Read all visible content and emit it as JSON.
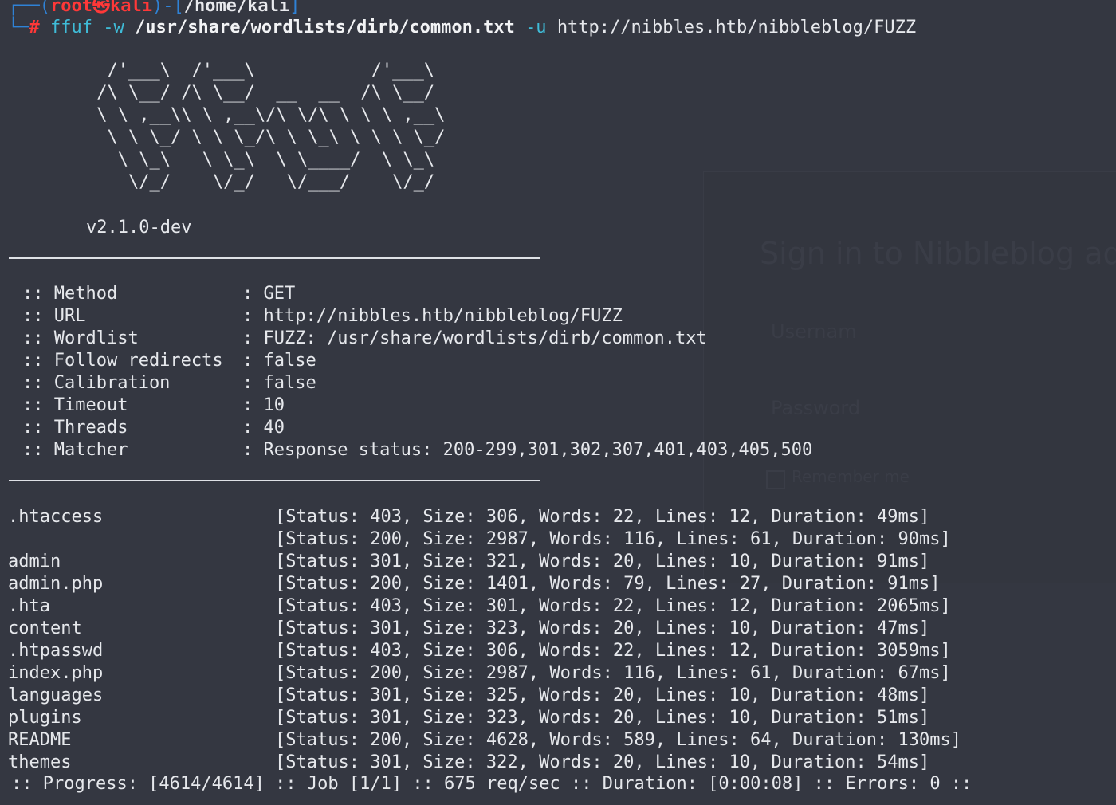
{
  "prompt": {
    "user": "root㉿kali",
    "path": "/home/kali",
    "hash": "#",
    "command": "ffuf",
    "wordlist_flag": "-w",
    "wordlist_path": "/usr/share/wordlists/dirb/common.txt",
    "url_flag": "-u",
    "url": "http://nibbles.htb/nibbleblog/FUZZ"
  },
  "banner": {
    "ascii": "  /'___\\  /'___\\           /'___\\\n /\\ \\__/ /\\ \\__/  __  __  /\\ \\__/\n \\ \\ ,__\\\\ \\ ,__\\/\\ \\/\\ \\ \\ \\ ,__\\\n  \\ \\ \\_/ \\ \\ \\_/\\ \\ \\_\\ \\ \\ \\ \\_/\n   \\ \\_\\   \\ \\_\\  \\ \\____/  \\ \\_\\\n    \\/_/    \\/_/   \\/___/    \\/_/",
    "version": "v2.1.0-dev"
  },
  "config": [
    {
      "key": ":: Method",
      "value": ": GET"
    },
    {
      "key": ":: URL",
      "value": ": http://nibbles.htb/nibbleblog/FUZZ"
    },
    {
      "key": ":: Wordlist",
      "value": ": FUZZ: /usr/share/wordlists/dirb/common.txt"
    },
    {
      "key": ":: Follow redirects",
      "value": ": false"
    },
    {
      "key": ":: Calibration",
      "value": ": false"
    },
    {
      "key": ":: Timeout",
      "value": ": 10"
    },
    {
      "key": ":: Threads",
      "value": ": 40"
    },
    {
      "key": ":: Matcher",
      "value": ": Response status: 200-299,301,302,307,401,403,405,500"
    }
  ],
  "results": [
    {
      "name": ".htaccess",
      "status": "[Status: 403, Size: 306, Words: 22, Lines: 12, Duration: 49ms]"
    },
    {
      "name": "",
      "status": "[Status: 200, Size: 2987, Words: 116, Lines: 61, Duration: 90ms]"
    },
    {
      "name": "admin",
      "status": "[Status: 301, Size: 321, Words: 20, Lines: 10, Duration: 91ms]"
    },
    {
      "name": "admin.php",
      "status": "[Status: 200, Size: 1401, Words: 79, Lines: 27, Duration: 91ms]"
    },
    {
      "name": ".hta",
      "status": "[Status: 403, Size: 301, Words: 22, Lines: 12, Duration: 2065ms]"
    },
    {
      "name": "content",
      "status": "[Status: 301, Size: 323, Words: 20, Lines: 10, Duration: 47ms]"
    },
    {
      "name": ".htpasswd",
      "status": "[Status: 403, Size: 306, Words: 22, Lines: 12, Duration: 3059ms]"
    },
    {
      "name": "index.php",
      "status": "[Status: 200, Size: 2987, Words: 116, Lines: 61, Duration: 67ms]"
    },
    {
      "name": "languages",
      "status": "[Status: 301, Size: 325, Words: 20, Lines: 10, Duration: 48ms]"
    },
    {
      "name": "plugins",
      "status": "[Status: 301, Size: 323, Words: 20, Lines: 10, Duration: 51ms]"
    },
    {
      "name": "README",
      "status": "[Status: 200, Size: 4628, Words: 589, Lines: 64, Duration: 130ms]"
    },
    {
      "name": "themes",
      "status": "[Status: 301, Size: 322, Words: 20, Lines: 10, Duration: 54ms]"
    }
  ],
  "progress": ":: Progress: [4614/4614] :: Job [1/1] :: 675 req/sec :: Duration: [0:00:08] :: Errors: 0 ::",
  "ghost_dialog": {
    "title": "Sign in to Nibbleblog admi",
    "username_placeholder": "Usernam",
    "password_placeholder": "Password",
    "remember_label": "Remember me"
  },
  "colors": {
    "background": "#343741",
    "prompt_frame": "#2f82d6",
    "root_user": "#ff3838",
    "command": "#3fbcd8",
    "text": "#e6e8ec"
  }
}
